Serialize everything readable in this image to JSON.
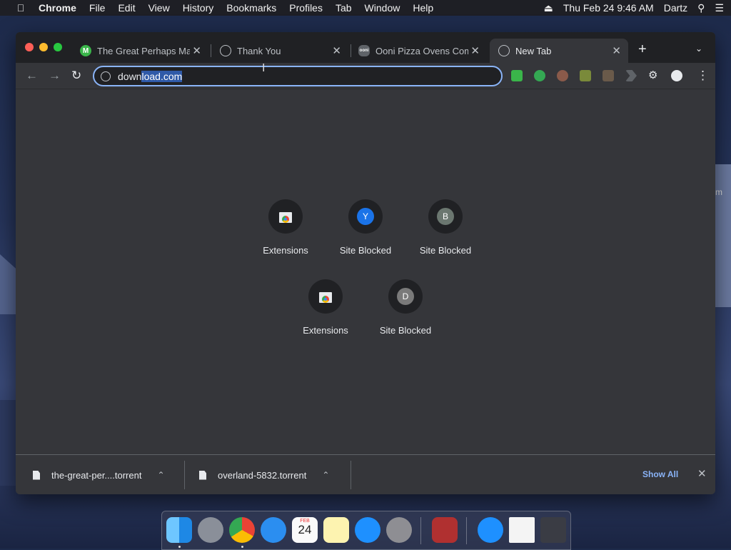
{
  "menubar": {
    "app": "Chrome",
    "items": [
      "File",
      "Edit",
      "View",
      "History",
      "Bookmarks",
      "Profiles",
      "Tab",
      "Window",
      "Help"
    ],
    "datetime": "Thu Feb 24  9:46 AM",
    "user": "Dartz"
  },
  "desktop": {
    "right_text": "m"
  },
  "tabs": [
    {
      "title": "The Great Perhaps Ma",
      "favicon": "M"
    },
    {
      "title": "Thank You",
      "favicon": ""
    },
    {
      "title": "Ooni Pizza Ovens Com",
      "favicon": "ooni"
    },
    {
      "title": "New Tab",
      "favicon": ""
    }
  ],
  "omnibox": {
    "url_before": "down",
    "url_selected": "load.com"
  },
  "shortcuts": [
    {
      "label": "Extensions",
      "letter": "",
      "icon": "chrome-web-store-icon"
    },
    {
      "label": "Site Blocked",
      "letter": "Y",
      "color": "#1a73e8"
    },
    {
      "label": "Site Blocked",
      "letter": "B",
      "color": "#6b7770"
    },
    {
      "label": "Extensions",
      "letter": "",
      "icon": "chrome-web-store-icon"
    },
    {
      "label": "Site Blocked",
      "letter": "D",
      "color": "#7a7a7a"
    }
  ],
  "downloads": {
    "items": [
      {
        "name": "the-great-per....torrent"
      },
      {
        "name": "overland-5832.torrent"
      }
    ],
    "show_all": "Show All"
  },
  "dock": {
    "calendar_month": "FEB",
    "calendar_day": "24"
  }
}
